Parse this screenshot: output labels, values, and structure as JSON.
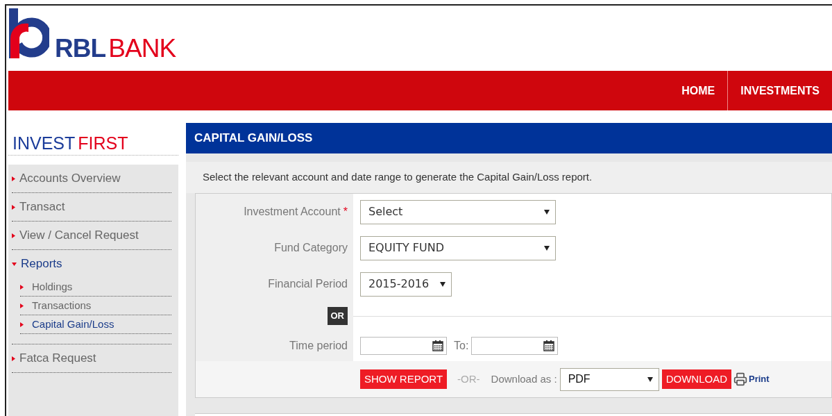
{
  "logo": {
    "part1": "RBL",
    "part2": "BANK"
  },
  "nav": [
    {
      "label": "HOME"
    },
    {
      "label": "INVESTMENTS"
    }
  ],
  "sidebar": {
    "title_part1": "INVEST",
    "title_part2": "FIRST",
    "items": [
      {
        "label": "Accounts Overview",
        "expanded": false
      },
      {
        "label": "Transact",
        "expanded": false
      },
      {
        "label": "View / Cancel Request",
        "expanded": false
      },
      {
        "label": "Reports",
        "expanded": true,
        "children": [
          {
            "label": "Holdings",
            "selected": false
          },
          {
            "label": "Transactions",
            "selected": false
          },
          {
            "label": "Capital Gain/Loss",
            "selected": true
          }
        ]
      },
      {
        "label": "Fatca Request",
        "expanded": false
      }
    ]
  },
  "panel": {
    "title": "CAPITAL GAIN/LOSS",
    "description": "Select the relevant account and date range to generate the Capital Gain/Loss report.",
    "fields": [
      {
        "kind": "select-wide",
        "label": "Investment Account",
        "required_mark": "*",
        "value": "Select"
      },
      {
        "kind": "select-wide",
        "label": "Fund Category",
        "value": "EQUITY FUND"
      },
      {
        "kind": "select-narrow",
        "label": "Financial Period",
        "value": "2015-2016"
      }
    ],
    "separator": "OR",
    "time_period": {
      "label": "Time period",
      "to_label": "To:"
    },
    "actions": {
      "show_report": "SHOW REPORT",
      "or": "-OR-",
      "download_label": "Download as :",
      "format": "PDF",
      "download": "DOWNLOAD",
      "print": "Print"
    }
  }
}
